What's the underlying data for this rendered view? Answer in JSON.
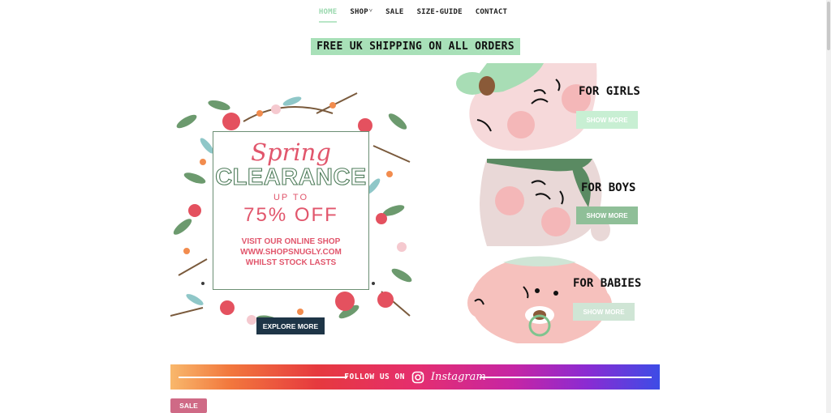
{
  "nav": {
    "items": [
      {
        "label": "HOME",
        "active": true
      },
      {
        "label": "SHOP",
        "has_dropdown": true
      },
      {
        "label": "SALE"
      },
      {
        "label": "SIZE-GUIDE"
      },
      {
        "label": "CONTACT"
      }
    ],
    "caret": "˅"
  },
  "shipping": {
    "text": "FREE UK SHIPPING ON ALL ORDERS"
  },
  "promo": {
    "spring": "Spring",
    "clearance": "CLEARANCE",
    "up_to": "UP TO",
    "discount": "75% OFF",
    "visit_lines": [
      "VISIT OUR ONLINE SHOP",
      "WWW.SHOPSNUGLY.COM",
      "WHILST STOCK LASTS"
    ],
    "button": "EXPLORE MORE"
  },
  "categories": [
    {
      "title": "FOR GIRLS",
      "button": "SHOW MORE",
      "button_color": "#c8efd3"
    },
    {
      "title": "FOR BOYS",
      "button": "SHOW MORE",
      "button_color": "#8fbf98"
    },
    {
      "title": "FOR BABIES",
      "button": "SHOW MORE",
      "button_color": "#cfe5d5"
    }
  ],
  "instagram": {
    "follow": "FOLLOW US ON",
    "brand": "Instagram"
  },
  "sale_badge": "SALE",
  "colors": {
    "accent_green": "#a8e0b8",
    "promo_pink": "#e1566c",
    "explore_navy": "#1e3547",
    "sale_pink": "#cf6a86"
  }
}
